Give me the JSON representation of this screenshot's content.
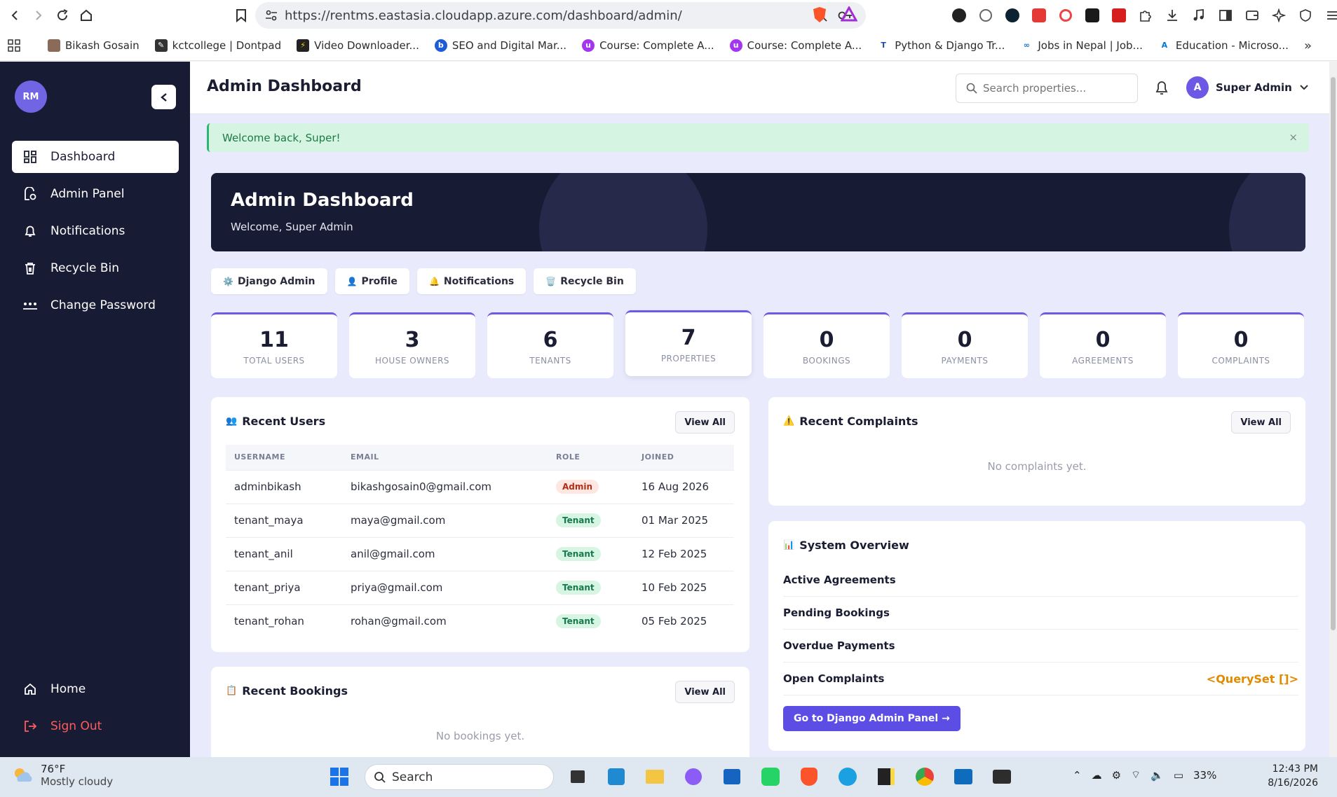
{
  "browser": {
    "url": "https://rentms.eastasia.cloudapp.azure.com/dashboard/admin/",
    "bookmarks": [
      "Bikash Gosain",
      "kctcollege | Dontpad",
      "Video Downloader...",
      "SEO and Digital Mar...",
      "Course: Complete A...",
      "Course: Complete A...",
      "Python & Django Tr...",
      "Jobs in Nepal | Job...",
      "Education - Microso..."
    ]
  },
  "sidebar": {
    "avatar_initials": "RM",
    "items": [
      {
        "label": "Dashboard",
        "icon": "dashboard-icon"
      },
      {
        "label": "Admin Panel",
        "icon": "admin-panel-icon"
      },
      {
        "label": "Notifications",
        "icon": "bell-icon"
      },
      {
        "label": "Recycle Bin",
        "icon": "trash-icon"
      },
      {
        "label": "Change Password",
        "icon": "password-icon"
      }
    ],
    "bottom": [
      {
        "label": "Home",
        "icon": "home-icon"
      },
      {
        "label": "Sign Out",
        "icon": "sign-out-icon"
      }
    ]
  },
  "header": {
    "title": "Admin Dashboard",
    "search_placeholder": "Search properties...",
    "user_initial": "A",
    "user_name": "Super Admin"
  },
  "alert": {
    "message": "Welcome back, Super!",
    "close": "×"
  },
  "hero": {
    "title": "Admin Dashboard",
    "subtitle": "Welcome, Super Admin"
  },
  "quick_links": [
    {
      "label": "Django Admin",
      "icon": "⚙️"
    },
    {
      "label": "Profile",
      "icon": "👤"
    },
    {
      "label": "Notifications",
      "icon": "🔔"
    },
    {
      "label": "Recycle Bin",
      "icon": "🗑️"
    }
  ],
  "stats": [
    {
      "value": "11",
      "label": "TOTAL USERS"
    },
    {
      "value": "3",
      "label": "HOUSE OWNERS"
    },
    {
      "value": "6",
      "label": "TENANTS"
    },
    {
      "value": "7",
      "label": "PROPERTIES"
    },
    {
      "value": "0",
      "label": "BOOKINGS"
    },
    {
      "value": "0",
      "label": "PAYMENTS"
    },
    {
      "value": "0",
      "label": "AGREEMENTS"
    },
    {
      "value": "0",
      "label": "COMPLAINTS"
    }
  ],
  "recent_users": {
    "title": "Recent Users",
    "icon": "👥",
    "view_all": "View All",
    "columns": [
      "USERNAME",
      "EMAIL",
      "ROLE",
      "JOINED"
    ],
    "rows": [
      {
        "username": "adminbikash",
        "email": "bikashgosain0@gmail.com",
        "role": "Admin",
        "joined": "16 Aug 2026"
      },
      {
        "username": "tenant_maya",
        "email": "maya@gmail.com",
        "role": "Tenant",
        "joined": "01 Mar 2025"
      },
      {
        "username": "tenant_anil",
        "email": "anil@gmail.com",
        "role": "Tenant",
        "joined": "12 Feb 2025"
      },
      {
        "username": "tenant_priya",
        "email": "priya@gmail.com",
        "role": "Tenant",
        "joined": "10 Feb 2025"
      },
      {
        "username": "tenant_rohan",
        "email": "rohan@gmail.com",
        "role": "Tenant",
        "joined": "05 Feb 2025"
      }
    ]
  },
  "recent_complaints": {
    "title": "Recent Complaints",
    "icon": "⚠️",
    "view_all": "View All",
    "empty": "No complaints yet."
  },
  "system_overview": {
    "title": "System Overview",
    "icon": "📊",
    "rows": [
      {
        "label": "Active Agreements",
        "value": ""
      },
      {
        "label": "Pending Bookings",
        "value": ""
      },
      {
        "label": "Overdue Payments",
        "value": ""
      },
      {
        "label": "Open Complaints",
        "value": "<QuerySet []>"
      }
    ],
    "button": "Go to Django Admin Panel →"
  },
  "recent_bookings": {
    "title": "Recent Bookings",
    "icon": "📋",
    "view_all": "View All",
    "empty": "No bookings yet."
  },
  "taskbar": {
    "temp": "76°F",
    "condition": "Mostly cloudy",
    "search": "Search",
    "battery": "33%",
    "time": "12:43 PM",
    "date": "8/16/2026"
  },
  "colors": {
    "sidebar": "#181b34",
    "accent": "#6b5ae5",
    "warning": "#e08a00"
  }
}
